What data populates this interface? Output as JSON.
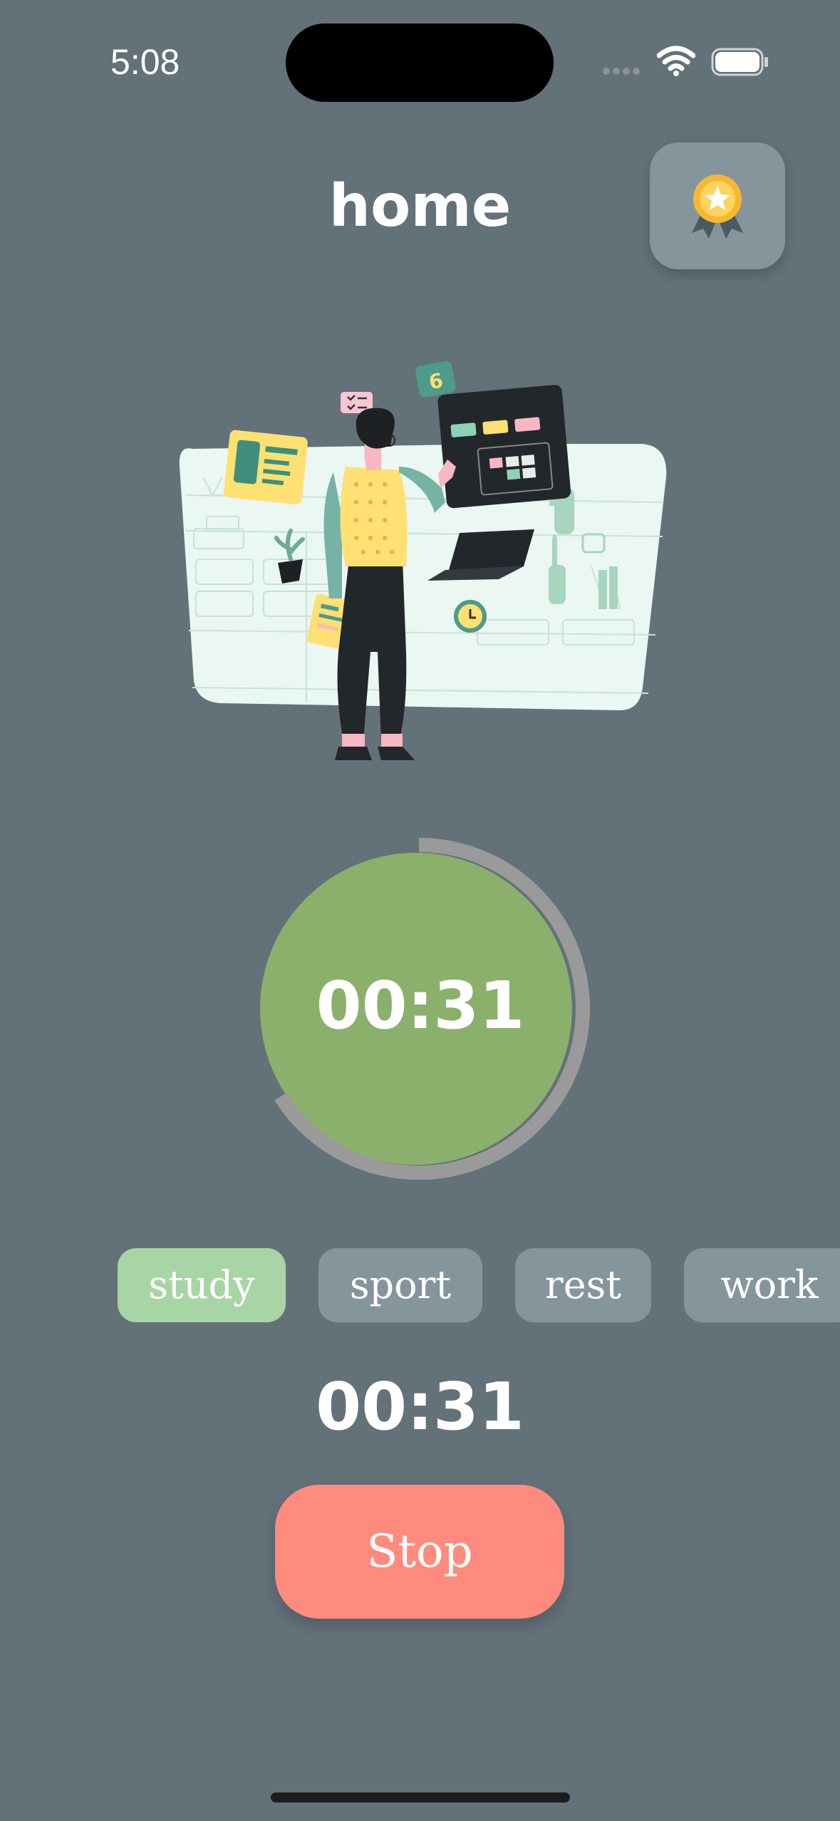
{
  "status_bar": {
    "time": "5:08",
    "icons": [
      "signal-icon",
      "wifi-icon",
      "battery-icon"
    ]
  },
  "header": {
    "title": "home",
    "award_icon": "award-ribbon-icon"
  },
  "timer": {
    "display": "00:31",
    "progress": 0.66
  },
  "categories": [
    {
      "label": "study",
      "selected": true
    },
    {
      "label": "sport",
      "selected": false
    },
    {
      "label": "rest",
      "selected": false
    },
    {
      "label": "work",
      "selected": false
    }
  ],
  "elapsed": "00:31",
  "actions": {
    "stop_label": "Stop"
  },
  "colors": {
    "background": "#637179",
    "accent_green": "#8bb06b",
    "chip": "#85959c",
    "chip_active": "#a8d5a6",
    "stop": "#fe8b7e",
    "ring_track": "#9a9a9a"
  }
}
